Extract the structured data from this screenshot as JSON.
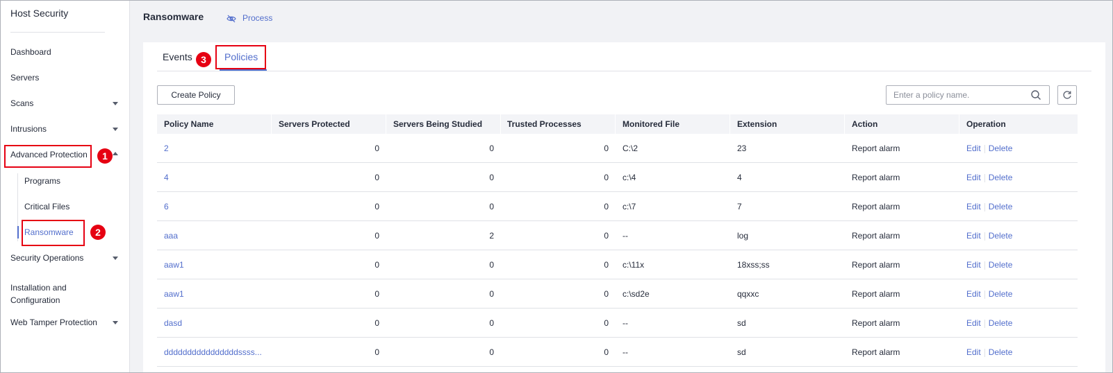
{
  "sidebar": {
    "title": "Host Security",
    "items": [
      {
        "label": "Dashboard"
      },
      {
        "label": "Servers"
      },
      {
        "label": "Scans"
      },
      {
        "label": "Intrusions"
      },
      {
        "label": "Advanced Protection"
      },
      {
        "label": "Security Operations"
      },
      {
        "label": "Installation and"
      },
      {
        "label": "Configuration"
      },
      {
        "label": "Web Tamper Protection"
      }
    ],
    "sub_items": [
      {
        "label": "Programs"
      },
      {
        "label": "Critical Files"
      },
      {
        "label": "Ransomware"
      }
    ]
  },
  "annotations": {
    "one": "1",
    "two": "2",
    "three": "3"
  },
  "header": {
    "title": "Ransomware",
    "process_link": "Process"
  },
  "tabs": [
    {
      "label": "Events"
    },
    {
      "label": "Policies"
    }
  ],
  "toolbar": {
    "create_label": "Create Policy",
    "search_placeholder": "Enter a policy name."
  },
  "table": {
    "columns": [
      "Policy Name",
      "Servers Protected",
      "Servers Being Studied",
      "Trusted Processes",
      "Monitored File",
      "Extension",
      "Action",
      "Operation"
    ],
    "rows": [
      {
        "name": "2",
        "protected": "0",
        "studied": "0",
        "trusted": "0",
        "file": "C:\\2",
        "ext": "23",
        "action": "Report alarm"
      },
      {
        "name": "4",
        "protected": "0",
        "studied": "0",
        "trusted": "0",
        "file": "c:\\4",
        "ext": "4",
        "action": "Report alarm"
      },
      {
        "name": "6",
        "protected": "0",
        "studied": "0",
        "trusted": "0",
        "file": "c:\\7",
        "ext": "7",
        "action": "Report alarm"
      },
      {
        "name": "aaa",
        "protected": "0",
        "studied": "2",
        "trusted": "0",
        "file": "--",
        "ext": "log",
        "action": "Report alarm"
      },
      {
        "name": "aaw1",
        "protected": "0",
        "studied": "0",
        "trusted": "0",
        "file": "c:\\11x",
        "ext": "18xss;ss",
        "action": "Report alarm"
      },
      {
        "name": "aaw1",
        "protected": "0",
        "studied": "0",
        "trusted": "0",
        "file": "c:\\sd2e",
        "ext": "qqxxc",
        "action": "Report alarm"
      },
      {
        "name": "dasd",
        "protected": "0",
        "studied": "0",
        "trusted": "0",
        "file": "--",
        "ext": "sd",
        "action": "Report alarm"
      },
      {
        "name": "ddddddddddddddddssss...",
        "protected": "0",
        "studied": "0",
        "trusted": "0",
        "file": "--",
        "ext": "sd",
        "action": "Report alarm"
      }
    ],
    "edit_label": "Edit",
    "delete_label": "Delete"
  },
  "colors": {
    "accent": "#526ecc",
    "annotation": "#e60012"
  }
}
